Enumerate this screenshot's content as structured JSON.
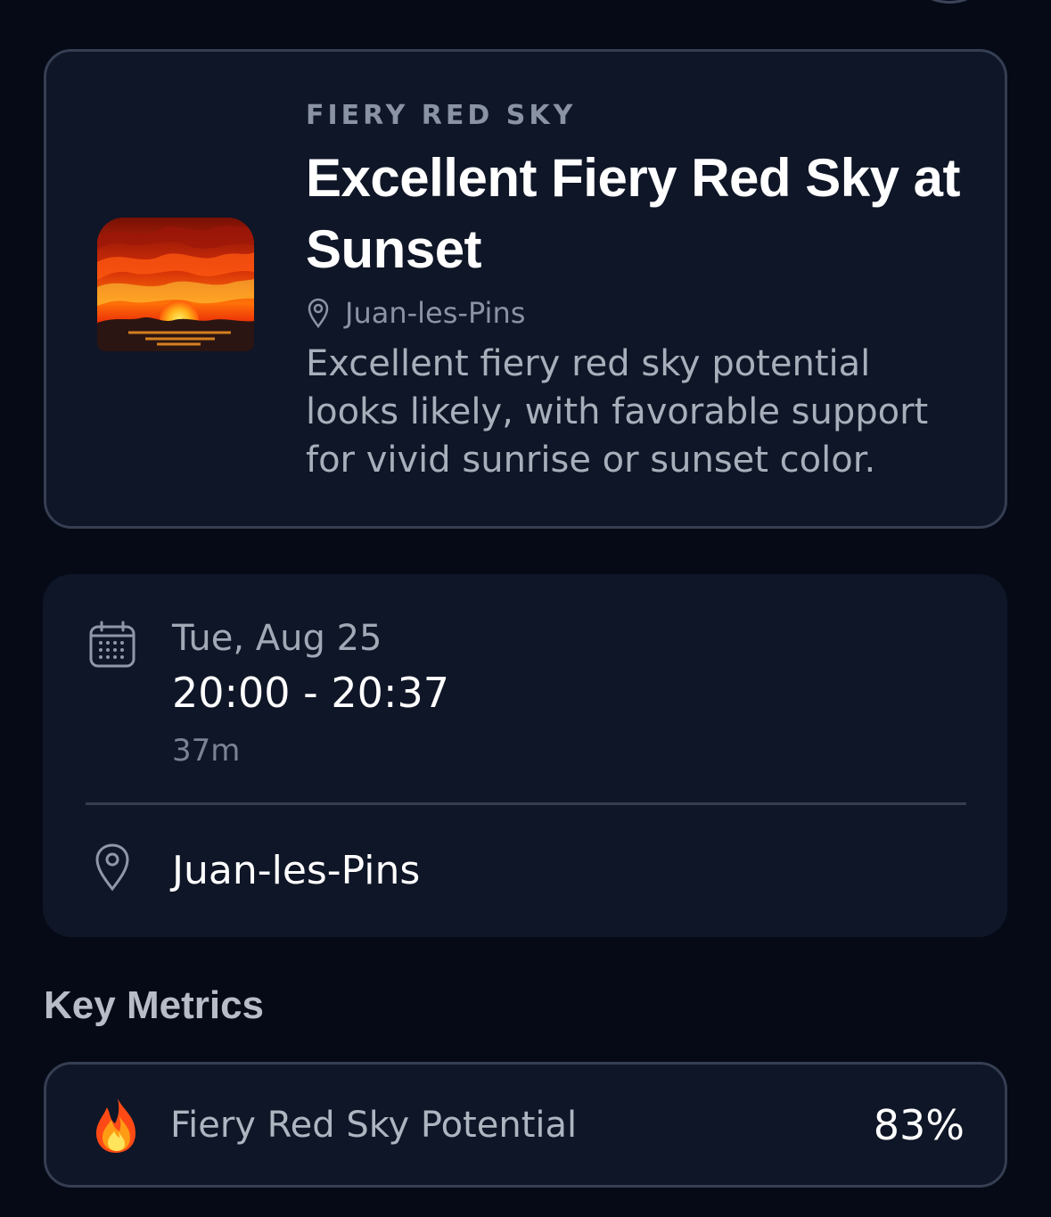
{
  "hero": {
    "category": "FIERY RED SKY",
    "title": "Excellent Fiery Red Sky at Sunset",
    "location": "Juan-les-Pins",
    "description": "Excellent fiery red sky potential looks likely, with favorable support for vivid sunrise or sunset color.",
    "icon": "sunset-image"
  },
  "details": {
    "date": "Tue, Aug 25",
    "time_range": "20:00 - 20:37",
    "duration": "37m",
    "location": "Juan-les-Pins",
    "icons": [
      "calendar-icon",
      "location-pin-icon"
    ]
  },
  "metrics": {
    "section_title": "Key Metrics",
    "items": [
      {
        "icon": "fire-icon",
        "label": "Fiery Red Sky Potential",
        "value": "83%"
      }
    ]
  },
  "colors": {
    "background": "#050a16",
    "card": "#0f1627",
    "border": "#353e52",
    "primary_text": "#ffffff",
    "secondary_text": "#a8afbb",
    "muted_text": "#8a93a3"
  }
}
